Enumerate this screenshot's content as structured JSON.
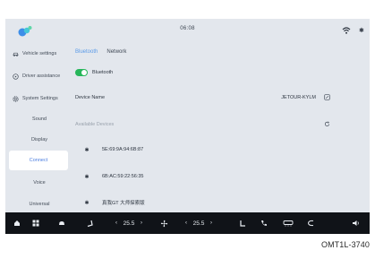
{
  "status": {
    "time": "06:08"
  },
  "sidebar": {
    "top_items": [
      {
        "label": "Vehicle settings",
        "icon": "car-icon"
      },
      {
        "label": "Driver assistance",
        "icon": "steering-wheel-icon"
      },
      {
        "label": "System Settings",
        "icon": "gear-icon"
      }
    ],
    "sub_items": [
      {
        "label": "Sound"
      },
      {
        "label": "Display"
      },
      {
        "label": "Connect"
      },
      {
        "label": "Voice"
      },
      {
        "label": "Universal"
      }
    ],
    "active": "Connect"
  },
  "tabs": [
    {
      "label": "Bluetooth",
      "active": true
    },
    {
      "label": "Network",
      "active": false
    }
  ],
  "bluetooth": {
    "toggle_label": "Bluetooth",
    "enabled": true,
    "device_name_label": "Device Name",
    "device_name": "JETOUR-KYLM",
    "available_label": "Available Devices",
    "devices": [
      "5E:69:9A:94:6B:87",
      "6B:AC:59:22:56:35",
      "真我GT 大师探索版"
    ]
  },
  "bottombar": {
    "temp_left": "25.5",
    "temp_right": "25.5"
  },
  "caption": "OMT1L-3740",
  "colors": {
    "accent": "#5b9be8",
    "toggle_on": "#27b65a",
    "bar": "#101318"
  }
}
